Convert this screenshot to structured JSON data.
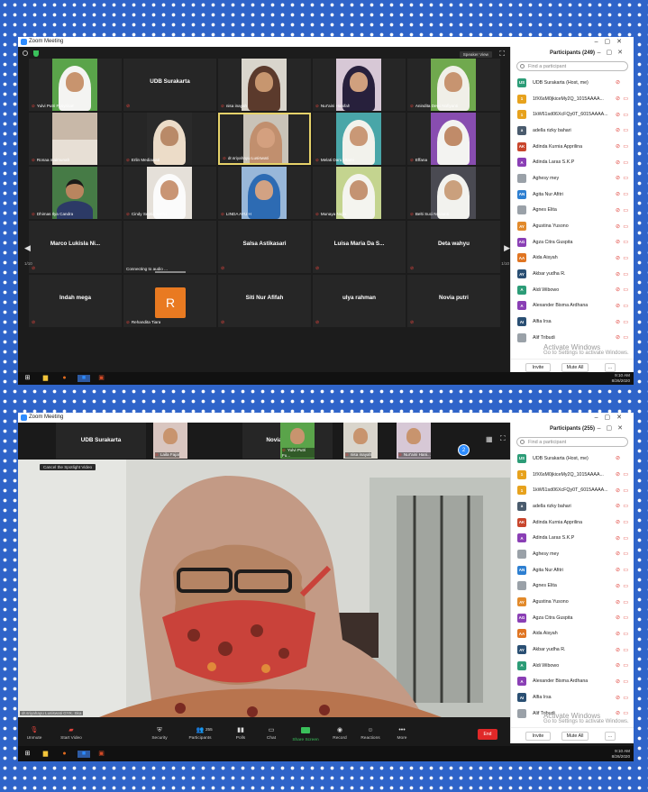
{
  "shot1": {
    "title": "Zoom Meeting",
    "speaker_view_label": "Speaker View",
    "panel_title": "Participants (249)",
    "search_placeholder": "Find a participant",
    "page_left": "1/10",
    "page_right": "1/10",
    "participants_count": "249",
    "tiles": [
      {
        "name": "Yulvi Putri Fusyrisari",
        "type": "hijab",
        "bg": "#5aa44a",
        "hijab": "#f4f4f2",
        "skin": "#c8946e"
      },
      {
        "name": "UDB Surakarta",
        "type": "text"
      },
      {
        "name": "nisa inayah",
        "type": "hijab",
        "bg": "#d9d5cc",
        "hijab": "#5b3a2c",
        "skin": "#c7966f"
      },
      {
        "name": "Nur'aini Hanifah",
        "type": "hijab",
        "bg": "#d7c8d6",
        "hijab": "#27203c",
        "skin": "#d0a07e"
      },
      {
        "name": "Anindita Dewi Nofiyanti",
        "type": "hijab",
        "bg": "#70a94e",
        "hijab": "#f0efe8",
        "skin": "#c79470"
      },
      {
        "name": "Ronaa maimunah",
        "type": "room",
        "bg": "#c8b8a8"
      },
      {
        "name": "Erlin Mediawati",
        "type": "hijab",
        "bg": "#2a2a2a",
        "hijab": "#ecdcc8",
        "skin": "#b98a68"
      },
      {
        "name": "dr.sriyahayu Lusiswati",
        "type": "hijab",
        "bg": "#c9c3b8",
        "hijab": "#c18f6e",
        "skin": "#d4a07f",
        "spotlight": true
      },
      {
        "name": "Melati Daru Utami",
        "type": "hijab",
        "bg": "#49a6a8",
        "hijab": "#f2f2ec",
        "skin": "#c99876"
      },
      {
        "name": "Effana",
        "type": "hijab",
        "bg": "#884db0",
        "hijab": "#f3f3f1",
        "skin": "#c08b69"
      },
      {
        "name": "Dhimas Ilya Candra",
        "type": "man",
        "bg": "#467b46",
        "skin": "#b9855f"
      },
      {
        "name": "Cindy Septia Safitri",
        "type": "hijab",
        "bg": "#e5e0d9",
        "hijab": "#fbfbfb",
        "skin": "#c99574"
      },
      {
        "name": "LINDA AYU H",
        "type": "hijab",
        "bg": "#98b7d9",
        "hijab": "#2d6bb3",
        "skin": "#d2a283"
      },
      {
        "name": "Munaya Najla",
        "type": "hijab",
        "bg": "#c4d48f",
        "hijab": "#f4f4ef",
        "skin": "#c49372"
      },
      {
        "name": "Belti Suci Novianti",
        "type": "hijab",
        "bg": "#4a4a52",
        "hijab": "#f2f2ee",
        "skin": "#caa07d"
      },
      {
        "name": "Marco Lukisla Ni...",
        "type": "text"
      },
      {
        "name": "Connecting to audio ...",
        "type": "blank"
      },
      {
        "name": "Salsa Astikasari",
        "type": "text"
      },
      {
        "name": "Luisa Maria Da S...",
        "type": "text"
      },
      {
        "name": "Deta wahyu",
        "type": "text"
      },
      {
        "name": "Indah mega",
        "type": "text"
      },
      {
        "name": "Rehandita Tiara",
        "type": "letter",
        "letter": "R"
      },
      {
        "name": "Siti Nur Afifah",
        "type": "text"
      },
      {
        "name": "ulya rahman",
        "type": "text"
      },
      {
        "name": "Novia putri",
        "type": "text"
      }
    ],
    "taskbar_time": "9:10 AM",
    "taskbar_date": "8/26/2020"
  },
  "shot2": {
    "title": "Zoom Meeting",
    "panel_title": "Participants (255)",
    "search_placeholder": "Find a participant",
    "participants_count": "255",
    "strip": [
      {
        "name": "UDB Surakarta",
        "type": "text"
      },
      {
        "name": "Laila Fajar",
        "type": "photo",
        "bg": "#d9c6c0"
      },
      {
        "name": "Noviana Fitriani",
        "type": "text"
      },
      {
        "name": "Yulvi Putri Fu...",
        "type": "photo",
        "bg": "#5aa44a"
      },
      {
        "name": "nisa inayah",
        "type": "photo",
        "bg": "#d9d5cc"
      },
      {
        "name": "Nur'aini Hani...",
        "type": "photo",
        "bg": "#d7c8d6"
      }
    ],
    "badge": "2",
    "spotlight_label": "Cancel the Spotlight Video",
    "video_name": "dr.sriyahayu Lusiswati GYK. Ska",
    "taskbar_time": "9:10 AM",
    "taskbar_date": "8/26/2020"
  },
  "participants": [
    {
      "initials": "US",
      "name": "UDB Surakarta (Host, me)",
      "color": "#2c9c77"
    },
    {
      "initials": "1",
      "name": "1fX6sM0jkiceMy2Q_1015AAAA...",
      "color": "#e7a21d"
    },
    {
      "initials": "1",
      "name": "1kW61sd06XcFQy0T_6015AAAA...",
      "color": "#e7a21d"
    },
    {
      "initials": "a",
      "name": "adella rizky bahari",
      "color": "#4a5b6d"
    },
    {
      "initials": "AK",
      "name": "Adinda Kurnia Apprilina",
      "color": "#c8452c"
    },
    {
      "initials": "A",
      "name": "Adinda Laras S.K.P",
      "color": "#8a3fb5"
    },
    {
      "initials": "",
      "name": "Aghesy mey",
      "color": "#9aa1a8"
    },
    {
      "initials": "AN",
      "name": "Agita Nur Afitri",
      "color": "#2d7fd1"
    },
    {
      "initials": "",
      "name": "Agnes Elita",
      "color": "#9aa1a8"
    },
    {
      "initials": "AY",
      "name": "Agustina Yusono",
      "color": "#e28a2b"
    },
    {
      "initials": "AG",
      "name": "Agza Citra Guspita",
      "color": "#8a3fb5"
    },
    {
      "initials": "AA",
      "name": "Aida Aisyah",
      "color": "#e07522"
    },
    {
      "initials": "AY",
      "name": "Akbar yudha R.",
      "color": "#2a4f73"
    },
    {
      "initials": "A",
      "name": "Aldi Wibowo",
      "color": "#2c9c77"
    },
    {
      "initials": "A",
      "name": "Alexander Bisma Ardhana",
      "color": "#8a3fb5"
    },
    {
      "initials": "AI",
      "name": "Alfia Irsa",
      "color": "#2a4f73"
    },
    {
      "initials": "",
      "name": "Alif Tribudi",
      "color": "#9aa1a8"
    }
  ],
  "panel_footer": {
    "invite": "Invite",
    "mute_all": "Mute All",
    "more": "..."
  },
  "watermark": {
    "line1": "Activate Windows",
    "line2": "Go to Settings to activate Windows."
  },
  "toolbar": {
    "unmute": "Unmute",
    "start_video": "Start Video",
    "security": "Security",
    "participants": "Participants",
    "polls": "Polls",
    "chat": "Chat",
    "share_screen": "Share Screen",
    "record": "Record",
    "reactions": "Reactions",
    "more": "More",
    "end": "End"
  },
  "colors": {
    "accent": "#2d8cff",
    "end": "#e02828",
    "green": "#3ac15b",
    "muted": "#e0443c",
    "page_bg": "#2f64c9"
  }
}
